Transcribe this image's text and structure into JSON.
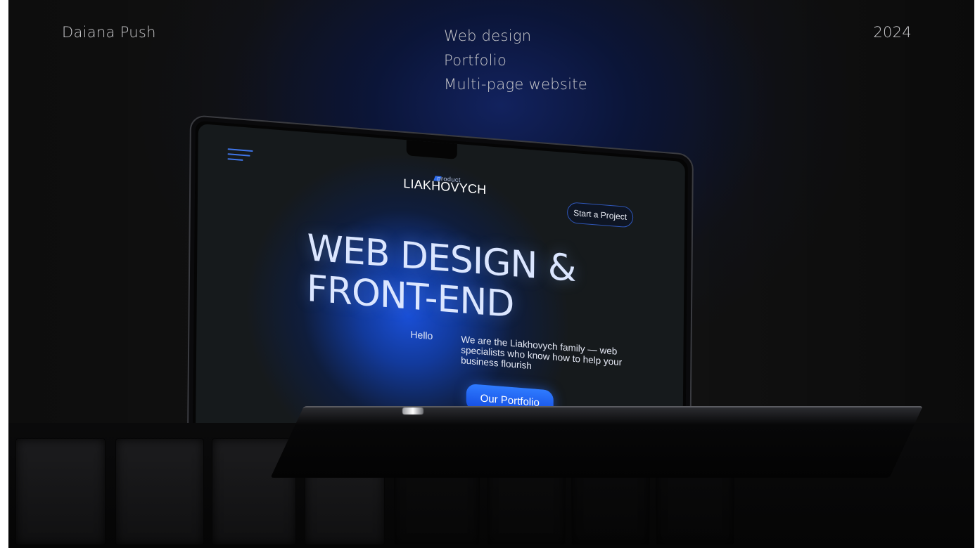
{
  "header": {
    "author": "Daiana Push",
    "year": "2024",
    "tags": [
      "Web design",
      "Portfolio",
      "Multi-page website"
    ]
  },
  "mockup": {
    "brand": {
      "sub": "product",
      "name": "LIAKHOVYCH"
    },
    "cta_label": "Start a Project",
    "hero_title_line1": "WEB DESIGN &",
    "hero_title_line2": "FRONT-END",
    "hello": "Hello",
    "intro": "We are the Liakhovych family — web specialists who know how to help your business flourish",
    "portfolio_label": "Our Portfolio",
    "menu_icon": "hamburger-menu-icon"
  },
  "colors": {
    "accent_blue": "#1f5cf0",
    "background": "#111111",
    "text_light": "#c9c9cc"
  }
}
